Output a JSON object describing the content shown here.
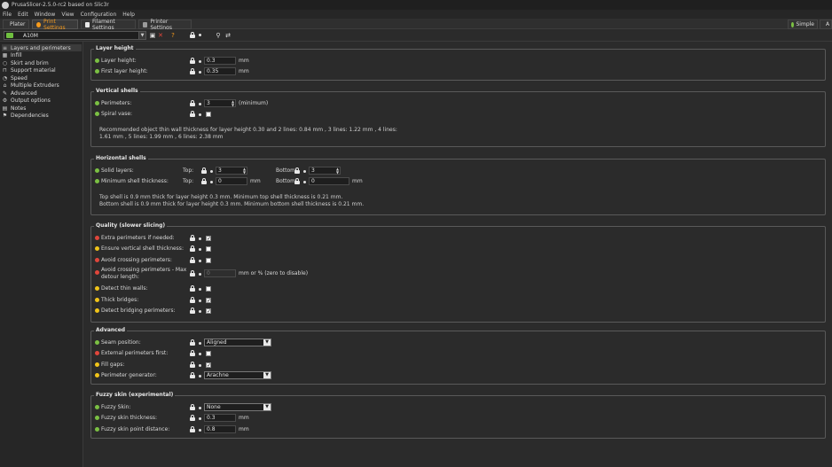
{
  "window": {
    "title": "PrusaSlicer-2.5.0-rc2 based on Slic3r"
  },
  "menu": [
    "File",
    "Edit",
    "Window",
    "View",
    "Configuration",
    "Help"
  ],
  "tabs": [
    {
      "label": "Plater"
    },
    {
      "label": "Print Settings"
    },
    {
      "label": "Filament Settings"
    },
    {
      "label": "Printer Settings"
    }
  ],
  "modes": {
    "simple": "Simple",
    "advanced": "A"
  },
  "preset": {
    "name": "A10M"
  },
  "sidebar": [
    "Layers and perimeters",
    "Infill",
    "Skirt and brim",
    "Support material",
    "Speed",
    "Multiple Extruders",
    "Advanced",
    "Output options",
    "Notes",
    "Dependencies"
  ],
  "layer_height": {
    "title": "Layer height",
    "layer_height": {
      "label": "Layer height:",
      "value": "0.3",
      "unit": "mm"
    },
    "first_layer_height": {
      "label": "First layer height:",
      "value": "0.35",
      "unit": "mm"
    }
  },
  "vertical_shells": {
    "title": "Vertical shells",
    "perimeters": {
      "label": "Perimeters:",
      "value": "3",
      "note": "(minimum)"
    },
    "spiral_vase": {
      "label": "Spiral vase:",
      "checked": false
    },
    "info_1": "Recommended object thin wall thickness for layer height 0.30 and 2 lines: 0.84 mm , 3 lines: 1.22 mm , 4 lines:",
    "info_2": "1.61 mm , 5 lines: 1.99 mm , 6 lines: 2.38 mm"
  },
  "horizontal_shells": {
    "title": "Horizontal shells",
    "solid_layers": {
      "label": "Solid layers:",
      "top_label": "Top:",
      "top": "3",
      "bottom_label": "Bottom:",
      "bottom": "3"
    },
    "min_shell": {
      "label": "Minimum shell thickness:",
      "top_label": "Top:",
      "top": "0",
      "top_unit": "mm",
      "bottom_label": "Bottom:",
      "bottom": "0",
      "bottom_unit": "mm"
    },
    "info_1": "Top shell is 0.9 mm thick for layer height 0.3 mm. Minimum top shell thickness is 0.21 mm.",
    "info_2": "Bottom shell is 0.9 mm thick for layer height 0.3 mm. Minimum bottom shell thickness is 0.21 mm."
  },
  "quality": {
    "title": "Quality (slower slicing)",
    "extra_perimeters": {
      "label": "Extra perimeters if needed:",
      "checked": true
    },
    "ensure_vertical": {
      "label": "Ensure vertical shell thickness:",
      "checked": false
    },
    "avoid_crossing": {
      "label": "Avoid crossing perimeters:",
      "checked": false
    },
    "avoid_max_detour": {
      "label_1": "Avoid crossing perimeters - Max",
      "label_2": "detour length:",
      "value": "0",
      "unit": "mm or % (zero to disable)"
    },
    "detect_thin_walls": {
      "label": "Detect thin walls:",
      "checked": false
    },
    "thick_bridges": {
      "label": "Thick bridges:",
      "checked": true
    },
    "detect_bridging": {
      "label": "Detect bridging perimeters:",
      "checked": true
    }
  },
  "advanced": {
    "title": "Advanced",
    "seam_position": {
      "label": "Seam position:",
      "value": "Aligned"
    },
    "external_first": {
      "label": "External perimeters first:",
      "checked": false
    },
    "fill_gaps": {
      "label": "Fill gaps:",
      "checked": true
    },
    "perimeter_generator": {
      "label": "Perimeter generator:",
      "value": "Arachne"
    }
  },
  "fuzzy": {
    "title": "Fuzzy skin (experimental)",
    "fuzzy_skin": {
      "label": "Fuzzy Skin:",
      "value": "None"
    },
    "thickness": {
      "label": "Fuzzy skin thickness:",
      "value": "0.3",
      "unit": "mm"
    },
    "point_distance": {
      "label": "Fuzzy skin point distance:",
      "value": "0.8",
      "unit": "mm"
    }
  },
  "colors": {
    "accent": "#f79b1c",
    "green": "#7bc043",
    "yellow": "#f0c419",
    "red": "#e0463b"
  }
}
